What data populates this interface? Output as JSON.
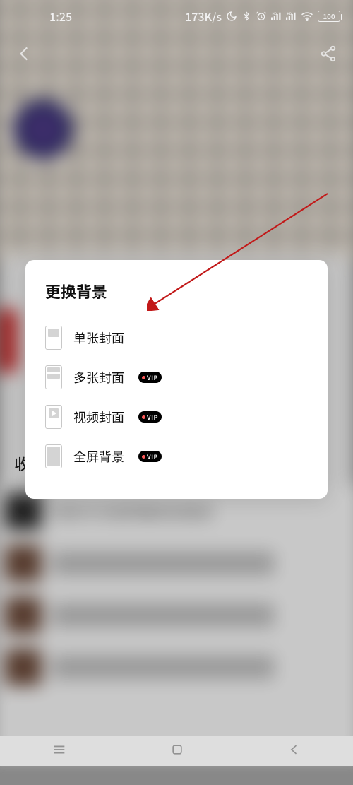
{
  "status": {
    "time": "1:25",
    "net_speed": "173K/s",
    "battery_text": "100"
  },
  "modal": {
    "title": "更换背景",
    "options": [
      {
        "label": "单张封面",
        "vip": false
      },
      {
        "label": "多张封面",
        "vip": true
      },
      {
        "label": "视频封面",
        "vip": true
      },
      {
        "label": "全屏背景",
        "vip": true
      }
    ],
    "vip_label": "VIP"
  },
  "background": {
    "visible_row_title": "你的子文老师喜欢的音乐",
    "section_prefix": "收"
  }
}
